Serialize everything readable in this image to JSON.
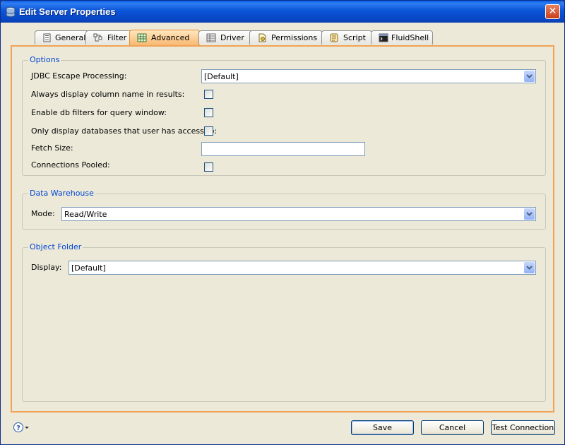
{
  "window": {
    "title": "Edit Server Properties"
  },
  "tabs": [
    {
      "label": "General",
      "icon": "general-icon",
      "active": false
    },
    {
      "label": "Filter",
      "icon": "filter-icon",
      "active": false
    },
    {
      "label": "Advanced",
      "icon": "advanced-icon",
      "active": true
    },
    {
      "label": "Driver",
      "icon": "driver-icon",
      "active": false
    },
    {
      "label": "Permissions",
      "icon": "permissions-icon",
      "active": false
    },
    {
      "label": "Script",
      "icon": "script-icon",
      "active": false
    },
    {
      "label": "FluidShell",
      "icon": "fluidshell-icon",
      "active": false
    }
  ],
  "options": {
    "legend": "Options",
    "jdbc_label": "JDBC Escape Processing:",
    "jdbc_value": "[Default]",
    "always_display_label": "Always display column name in results:",
    "always_display_checked": false,
    "enable_db_filters_label": "Enable db filters for query window:",
    "enable_db_filters_checked": false,
    "only_display_label": "Only display databases that user has access to:",
    "only_display_checked": false,
    "fetch_size_label": "Fetch Size:",
    "fetch_size_value": "",
    "connections_pooled_label": "Connections Pooled:",
    "connections_pooled_checked": false
  },
  "data_warehouse": {
    "legend": "Data Warehouse",
    "mode_label": "Mode:",
    "mode_value": "Read/Write"
  },
  "object_folder": {
    "legend": "Object Folder",
    "display_label": "Display:",
    "display_value": "[Default]"
  },
  "buttons": {
    "save": "Save",
    "cancel": "Cancel",
    "test_connection": "Test Connection"
  },
  "colors": {
    "accent": "#0046d5",
    "active_tab": "#f8b870",
    "panel_border": "#f0a356"
  }
}
